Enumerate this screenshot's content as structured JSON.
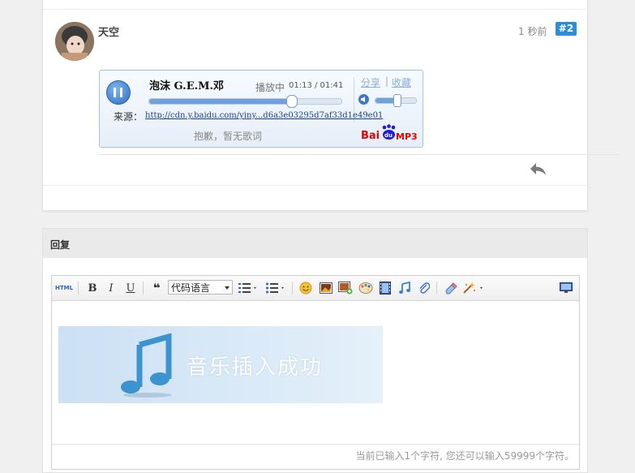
{
  "post": {
    "username": "天空",
    "time": "1 秒前",
    "floor": "#2"
  },
  "player": {
    "song_title": "泡沫 G.E.M.邓",
    "status": "播放中",
    "time": "01:13 / 01:41",
    "share_label": "分享",
    "link_sep": "|",
    "favorite_label": "收藏",
    "progress": 0.74,
    "volume": 0.52,
    "source_label": "来源：",
    "source_url": "http://cdn.y.baidu.com/yiny...d6a3e03295d7af33d1e49e01",
    "no_lyrics": "抱歉，暂无歌词",
    "brand_bai": "Bai",
    "brand_du": "du",
    "brand_mp3": "MP3"
  },
  "reply": {
    "title": "回复",
    "toolbar": {
      "html_label": "HTML",
      "bold_label": "B",
      "italic_label": "I",
      "underline_label": "U",
      "quote_label": "❝",
      "code_select_value": "代码语言"
    },
    "music_banner_text": "音乐插入成功",
    "char_counter": "当前已输入1个字符, 您还可以输入59999个字符。"
  },
  "colors": {
    "accent": "#2c8fd6",
    "link": "#1d3f8f"
  }
}
